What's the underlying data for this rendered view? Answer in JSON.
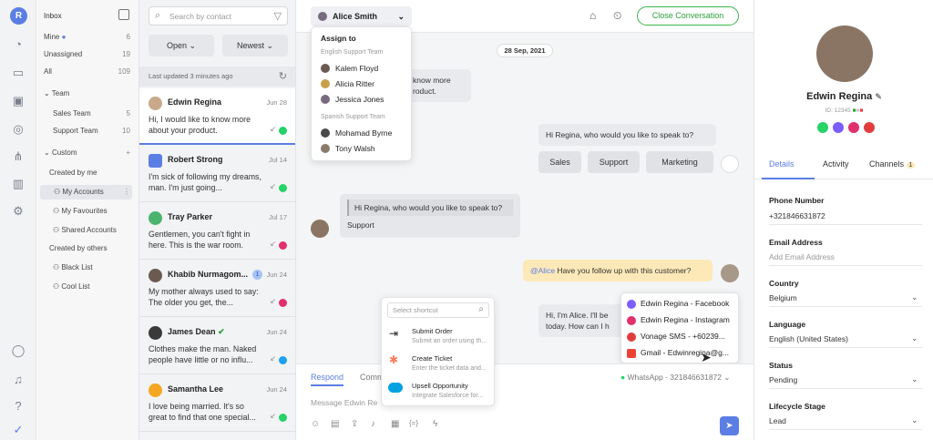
{
  "user_initial": "R",
  "nav": {
    "inbox_title": "Inbox",
    "mine": {
      "label": "Mine",
      "count": "6"
    },
    "unassigned": {
      "label": "Unassigned",
      "count": "19"
    },
    "all": {
      "label": "All",
      "count": "109"
    },
    "team_title": "Team",
    "sales_team": {
      "label": "Sales Team",
      "count": "5"
    },
    "support_team": {
      "label": "Support Team",
      "count": "10"
    },
    "custom_title": "Custom",
    "created_by_me": "Created by me",
    "my_accounts": "My Accounts",
    "my_favourites": "My Favourites",
    "shared_accounts": "Shared Accounts",
    "created_by_others": "Created by others",
    "black_list": "Black List",
    "cool_list": "Cool List"
  },
  "list": {
    "search_placeholder": "Search by contact",
    "filter_open": "Open",
    "filter_newest": "Newest",
    "updated": "Last updated 3 minutes ago",
    "conversations": [
      {
        "name": "Edwin Regina",
        "date": "Jun 28",
        "message": "Hi, I would like to know more about your product.",
        "channel_color": "#25d366"
      },
      {
        "name": "Robert Strong",
        "date": "Jul 14",
        "message": "I'm sick of following my dreams, man. I'm just going...",
        "channel_color": "#25d366"
      },
      {
        "name": "Tray Parker",
        "date": "Jul 17",
        "message": "Gentlemen, you can't fight in here. This is the war room.",
        "channel_color": "#e1306c"
      },
      {
        "name": "Khabib Nurmagom...",
        "date": "Jun 24",
        "badge": "1",
        "message": "My mother always used to say: The older you get, the...",
        "channel_color": "#e1306c"
      },
      {
        "name": "James Dean",
        "date": "Jun 24",
        "message": "Clothes make the man. Naked people have little or no influ...",
        "channel_color": "#1da1f2"
      },
      {
        "name": "Samantha Lee",
        "date": "Jun 24",
        "message": "I love being married. It's so great to find that one special...",
        "channel_color": "#25d366"
      }
    ]
  },
  "chat": {
    "assignee": "Alice Smith",
    "close_label": "Close Conversation",
    "date": "28 Sep, 2021",
    "assign_title": "Assign to",
    "group1": "English Support Team",
    "group1_members": [
      "Kalem Floyd",
      "Alicia Ritter",
      "Jessica Jones"
    ],
    "group2": "Spanish Support Team",
    "group2_members": [
      "Mohamad Byrne",
      "Tony Walsh"
    ],
    "msg_partial": "know more\nroduct.",
    "msg_question": "Hi Regina, who would you like to speak to?",
    "quick_replies": [
      "Sales",
      "Support",
      "Marketing"
    ],
    "reply_quote": "Hi Regina, who would you like to speak to?",
    "reply_text": "Support",
    "note_mention": "@Alice",
    "note_text": " Have you follow up with this customer?",
    "msg_alice": "Hi, I'm Alice. I'll be\ntoday. How can I h",
    "tab_respond": "Respond",
    "tab_comment": "Comm",
    "channel_select": "WhatsApp - 321846631872",
    "message_placeholder": "Message Edwin Re",
    "shortcut_placeholder": "Select shortcut",
    "shortcuts": [
      {
        "title": "Submit Order",
        "desc": "Submit an order using th..."
      },
      {
        "title": "Create Ticket",
        "desc": "Enter the ticket data and..."
      },
      {
        "title": "Upsell Opportunity",
        "desc": "Integrate Salesforce for..."
      }
    ],
    "channel_options": [
      "Edwin Regina - Facebook",
      "Edwin Regina - Instagram",
      "Vonage SMS - +60239...",
      "Gmail - Edwinregina@g..."
    ]
  },
  "contact": {
    "name": "Edwin Regina",
    "id": "ID: 12345",
    "tabs": {
      "details": "Details",
      "activity": "Activity",
      "channels": "Channels",
      "channels_count": "1"
    },
    "phone_label": "Phone Number",
    "phone": "+321846631872",
    "email_label": "Email Address",
    "email_placeholder": "Add Email Address",
    "country_label": "Country",
    "country": "Belgium",
    "language_label": "Language",
    "language": "English (United States)",
    "status_label": "Status",
    "status": "Pending",
    "lifecycle_label": "Lifecycle Stage",
    "lifecycle": "Lead"
  }
}
